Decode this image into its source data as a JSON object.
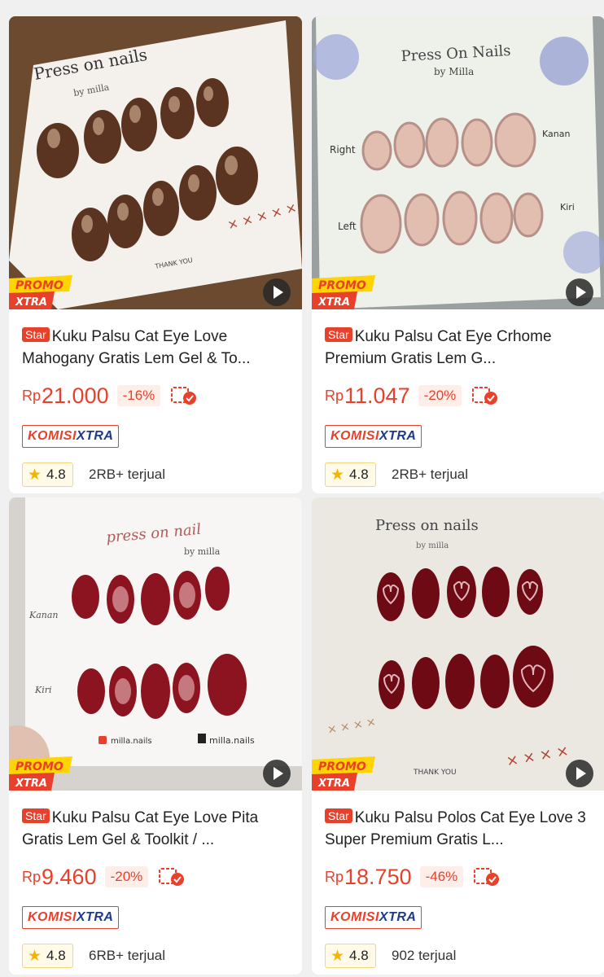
{
  "products": [
    {
      "star_label": "Star",
      "title": "Kuku Palsu Cat Eye Love Mahogany Gratis Lem Gel & To...",
      "currency": "Rp",
      "price": "21.000",
      "discount": "-16%",
      "commission_a": "KOMISI",
      "commission_b": "XTRA",
      "rating": "4.8",
      "sold": "2RB+ terjual",
      "promo_a": "PROMO",
      "promo_b": "XTRA",
      "card_brand": "Press on nails",
      "card_by": "by milla",
      "card_thanks": "THANK YOU"
    },
    {
      "star_label": "Star",
      "title": "Kuku Palsu Cat Eye Crhome Premium Gratis Lem G...",
      "currency": "Rp",
      "price": "11.047",
      "discount": "-20%",
      "commission_a": "KOMISI",
      "commission_b": "XTRA",
      "rating": "4.8",
      "sold": "2RB+ terjual",
      "promo_a": "PROMO",
      "promo_b": "XTRA",
      "card_brand": "Press On Nails",
      "card_by": "by Milla",
      "label_right": "Right",
      "label_kanan": "Kanan",
      "label_left": "Left",
      "label_kiri": "Kiri"
    },
    {
      "star_label": "Star",
      "title": "Kuku Palsu Cat Eye Love Pita Gratis Lem Gel & Toolkit / ...",
      "currency": "Rp",
      "price": "9.460",
      "discount": "-20%",
      "commission_a": "KOMISI",
      "commission_b": "XTRA",
      "rating": "4.8",
      "sold": "6RB+ terjual",
      "promo_a": "PROMO",
      "promo_b": "XTRA",
      "card_brand": "press on nail",
      "card_by": "by milla",
      "label_kanan": "Kanan",
      "label_kiri": "Kiri",
      "social_ig": "milla.nails",
      "social_tt": "milla.nails"
    },
    {
      "star_label": "Star",
      "title": "Kuku Palsu Polos Cat Eye Love 3 Super Premium Gratis L...",
      "currency": "Rp",
      "price": "18.750",
      "discount": "-46%",
      "commission_a": "KOMISI",
      "commission_b": "XTRA",
      "rating": "4.8",
      "sold": "902 terjual",
      "promo_a": "PROMO",
      "promo_b": "XTRA",
      "card_brand": "Press on nails",
      "card_by": "by milla",
      "card_thanks": "THANK YOU"
    }
  ],
  "colors": {
    "accent": "#e8402a",
    "komisi_blue": "#1e3a8a",
    "rating_star": "#f5b400"
  }
}
